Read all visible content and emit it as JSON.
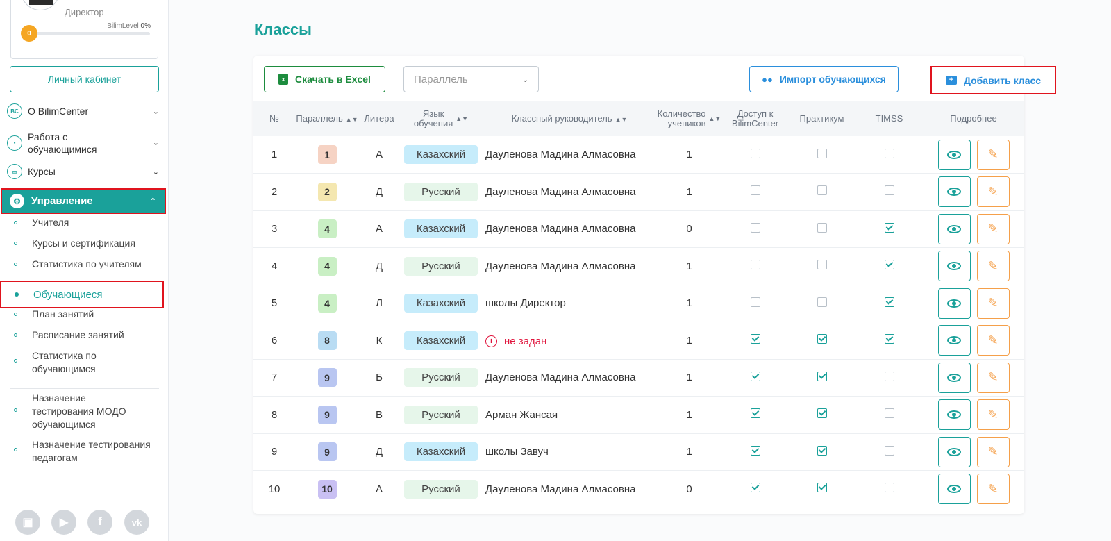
{
  "sidebar": {
    "profile": {
      "role": "Директор",
      "level_label": "BilimLevel",
      "level_percent": "0%",
      "level_value": "0"
    },
    "cabinet_label": "Личный кабинет",
    "menu": [
      {
        "icon": "bilimcenter-icon",
        "icon_text": "BC",
        "label": "О BilimCenter"
      },
      {
        "icon": "briefcase-icon",
        "icon_text": "▪",
        "label": "Работа с обучающимися"
      },
      {
        "icon": "monitor-icon",
        "icon_text": "▭",
        "label": "Курсы"
      }
    ],
    "active_menu": {
      "icon": "gear-icon",
      "label": "Управление"
    },
    "submenu": [
      "Учителя",
      "Курсы и сертификация",
      "Статистика по учителям",
      "Обучающиеся",
      "План занятий",
      "Расписание занятий",
      "Статистика по обучающимся",
      "Назначение тестирования МОДО обучающимся",
      "Назначение тестирования педагогам"
    ],
    "social": [
      "instagram-icon",
      "youtube-icon",
      "facebook-icon",
      "vk-icon"
    ]
  },
  "main": {
    "title": "Классы",
    "toolbar": {
      "excel_label": "Скачать в Excel",
      "parallel_placeholder": "Параллель",
      "import_label": "Импорт обучающихся",
      "add_label": "Добавить класс"
    },
    "table": {
      "headers": {
        "num": "№",
        "parallel": "Параллель",
        "litera": "Литера",
        "lang_1": "Язык",
        "lang_2": "обучения",
        "teacher": "Классный руководитель",
        "count_1": "Количество",
        "count_2": "учеников",
        "access_1": "Доступ к",
        "access_2": "BilimCenter",
        "practicum": "Практикум",
        "timss": "TIMSS",
        "details": "Подробнее"
      },
      "rows": [
        {
          "num": "1",
          "parallel": "1",
          "litera": "А",
          "lang": "Казахский",
          "teacher": "Дауленова Мадина Алмасовна",
          "count": "1",
          "access": false,
          "practicum": false,
          "timss": false
        },
        {
          "num": "2",
          "parallel": "2",
          "litera": "Д",
          "lang": "Русский",
          "teacher": "Дауленова Мадина Алмасовна",
          "count": "1",
          "access": false,
          "practicum": false,
          "timss": false
        },
        {
          "num": "3",
          "parallel": "4",
          "litera": "А",
          "lang": "Казахский",
          "teacher": "Дауленова Мадина Алмасовна",
          "count": "0",
          "access": false,
          "practicum": false,
          "timss": true
        },
        {
          "num": "4",
          "parallel": "4",
          "litera": "Д",
          "lang": "Русский",
          "teacher": "Дауленова Мадина Алмасовна",
          "count": "1",
          "access": false,
          "practicum": false,
          "timss": true
        },
        {
          "num": "5",
          "parallel": "4",
          "litera": "Л",
          "lang": "Казахский",
          "teacher": "школы Директор",
          "count": "1",
          "access": false,
          "practicum": false,
          "timss": true
        },
        {
          "num": "6",
          "parallel": "8",
          "litera": "К",
          "lang": "Казахский",
          "teacher": "не задан",
          "teacher_missing": true,
          "count": "1",
          "access": true,
          "practicum": true,
          "timss": true
        },
        {
          "num": "7",
          "parallel": "9",
          "litera": "Б",
          "lang": "Русский",
          "teacher": "Дауленова Мадина Алмасовна",
          "count": "1",
          "access": true,
          "practicum": true,
          "timss": false
        },
        {
          "num": "8",
          "parallel": "9",
          "litera": "В",
          "lang": "Русский",
          "teacher": "Арман Жансая",
          "count": "1",
          "access": true,
          "practicum": true,
          "timss": false
        },
        {
          "num": "9",
          "parallel": "9",
          "litera": "Д",
          "lang": "Казахский",
          "teacher": "школы Завуч",
          "count": "1",
          "access": true,
          "practicum": true,
          "timss": false
        },
        {
          "num": "10",
          "parallel": "10",
          "litera": "А",
          "lang": "Русский",
          "teacher": "Дауленова Мадина Алмасовна",
          "count": "0",
          "access": true,
          "practicum": true,
          "timss": false
        }
      ]
    },
    "colors": {
      "accent": "#1aa19a",
      "highlight": "#e0141e",
      "grade_1": "#f6d3c4",
      "grade_2": "#f4e7b0",
      "grade_4": "#c9efc4",
      "grade_8": "#b9dcf3",
      "grade_9": "#b9c6f1",
      "grade_10": "#c9c0f3"
    }
  }
}
